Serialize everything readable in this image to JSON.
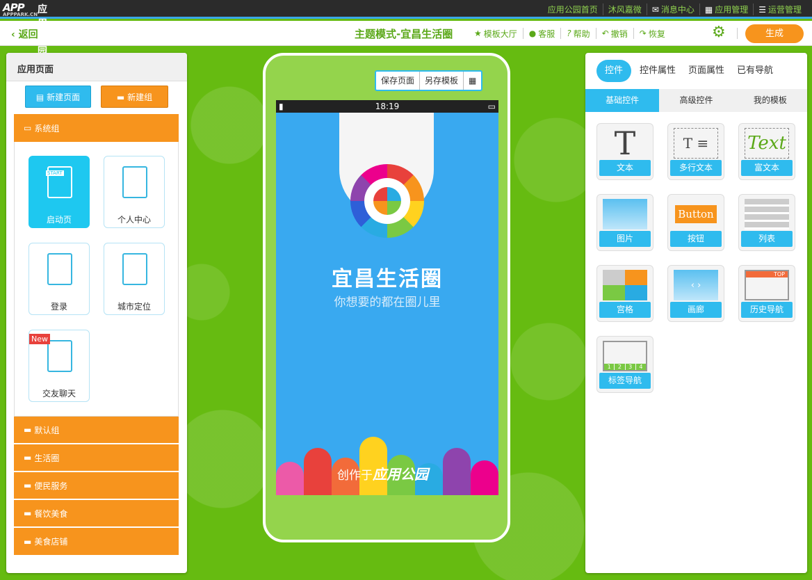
{
  "brand": {
    "logo": "APP",
    "logo_sub": "APPPARK.CN",
    "logo_cn": "应用公园"
  },
  "topnav": [
    "应用公园首页",
    "沐风嘉微",
    "消息中心",
    "应用管理",
    "运营管理"
  ],
  "toolbar": {
    "back": "返回",
    "title": "主题模式-宜昌生活圈",
    "buttons": [
      "模板大厅",
      "客服",
      "帮助",
      "撤销",
      "恢复"
    ],
    "generate": "生成"
  },
  "left": {
    "title": "应用页面",
    "new_page": "新建页面",
    "new_group": "新建组",
    "system_group": "系统组",
    "pages": [
      "启动页",
      "个人中心",
      "登录",
      "城市定位",
      "交友聊天"
    ],
    "new_badge": "New",
    "start_label": "START",
    "groups": [
      "默认组",
      "生活圈",
      "便民服务",
      "餐饮美食",
      "美食店铺"
    ]
  },
  "phone": {
    "buttons": [
      "保存页面",
      "另存模板"
    ],
    "time": "18:19",
    "app_name": "宜昌生活圈",
    "slogan": "你想要的都在圈儿里",
    "made_by": "创作于",
    "made_brand": "应用公园"
  },
  "right": {
    "tabs": [
      "控件",
      "控件属性",
      "页面属性",
      "已有导航"
    ],
    "subtabs": [
      "基础控件",
      "高级控件",
      "我的模板"
    ],
    "controls": [
      "文本",
      "多行文本",
      "富文本",
      "图片",
      "按钮",
      "列表",
      "宫格",
      "画廊",
      "历史导航",
      "标签导航"
    ],
    "samples": {
      "text": "T",
      "rich": "Text",
      "button": "Button",
      "top": "TOP",
      "tabs": [
        "1",
        "2",
        "3",
        "4"
      ]
    }
  },
  "colors": {
    "green": "#66bb11",
    "blue": "#2fbbee",
    "orange": "#f7941d"
  }
}
